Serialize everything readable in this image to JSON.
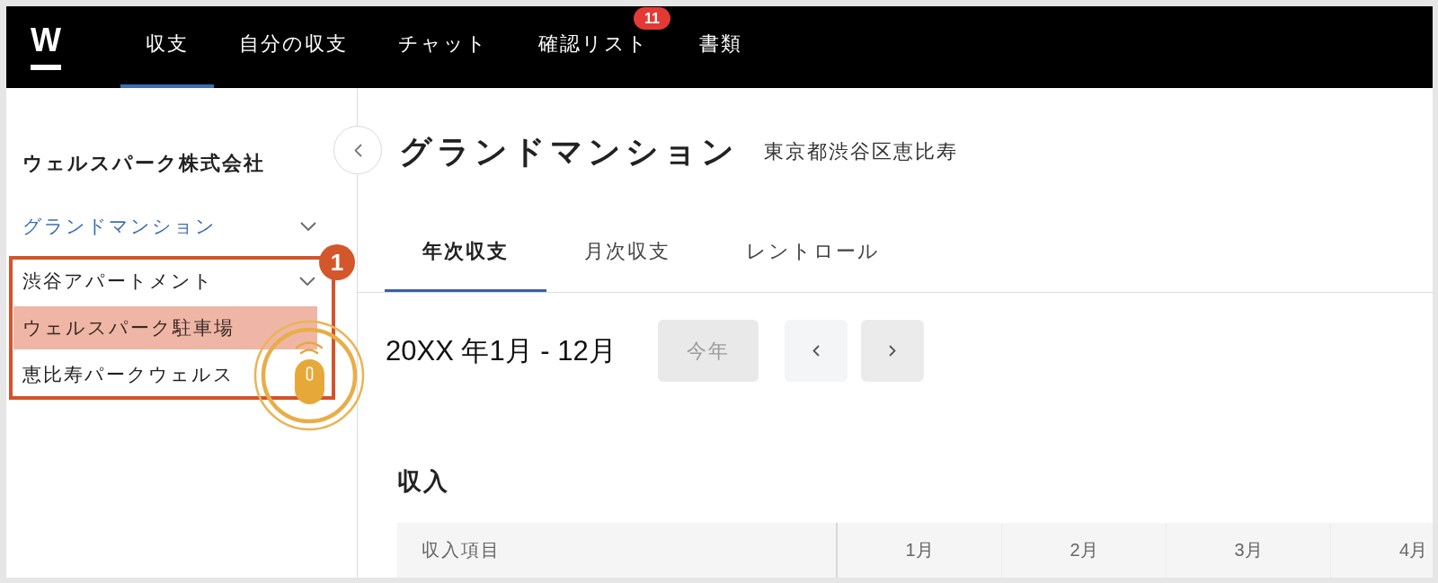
{
  "top_nav": {
    "logo": "W",
    "items": [
      {
        "label": "収支",
        "selected": true
      },
      {
        "label": "自分の収支",
        "selected": false
      },
      {
        "label": "チャット",
        "selected": false
      },
      {
        "label": "確認リスト",
        "selected": false,
        "badge": "11"
      },
      {
        "label": "書類",
        "selected": false
      }
    ]
  },
  "sidebar": {
    "company": "ウェルスパーク株式会社",
    "items": [
      {
        "label": "グランドマンション",
        "selected": true,
        "highlighted": false,
        "expandable": true,
        "in_callout": false
      },
      {
        "label": "渋谷アパートメント",
        "selected": false,
        "highlighted": false,
        "expandable": true,
        "in_callout": true
      },
      {
        "label": "ウェルスパーク駐車場",
        "selected": false,
        "highlighted": true,
        "expandable": false,
        "in_callout": true
      },
      {
        "label": "恵比寿パークウェルス",
        "selected": false,
        "highlighted": false,
        "expandable": false,
        "in_callout": true
      }
    ]
  },
  "callout": {
    "number": "1"
  },
  "property": {
    "name": "グランドマンション",
    "address": "東京都渋谷区恵比寿"
  },
  "tabs": [
    {
      "label": "年次収支",
      "selected": true
    },
    {
      "label": "月次収支",
      "selected": false
    },
    {
      "label": "レントロール",
      "selected": false
    }
  ],
  "period": {
    "label": "20XX 年1月 - 12月",
    "this_year_button": {
      "label": "今年",
      "disabled": true
    }
  },
  "income": {
    "title": "収入",
    "columns": [
      "収入項目",
      "1月",
      "2月",
      "3月",
      "4月"
    ]
  }
}
